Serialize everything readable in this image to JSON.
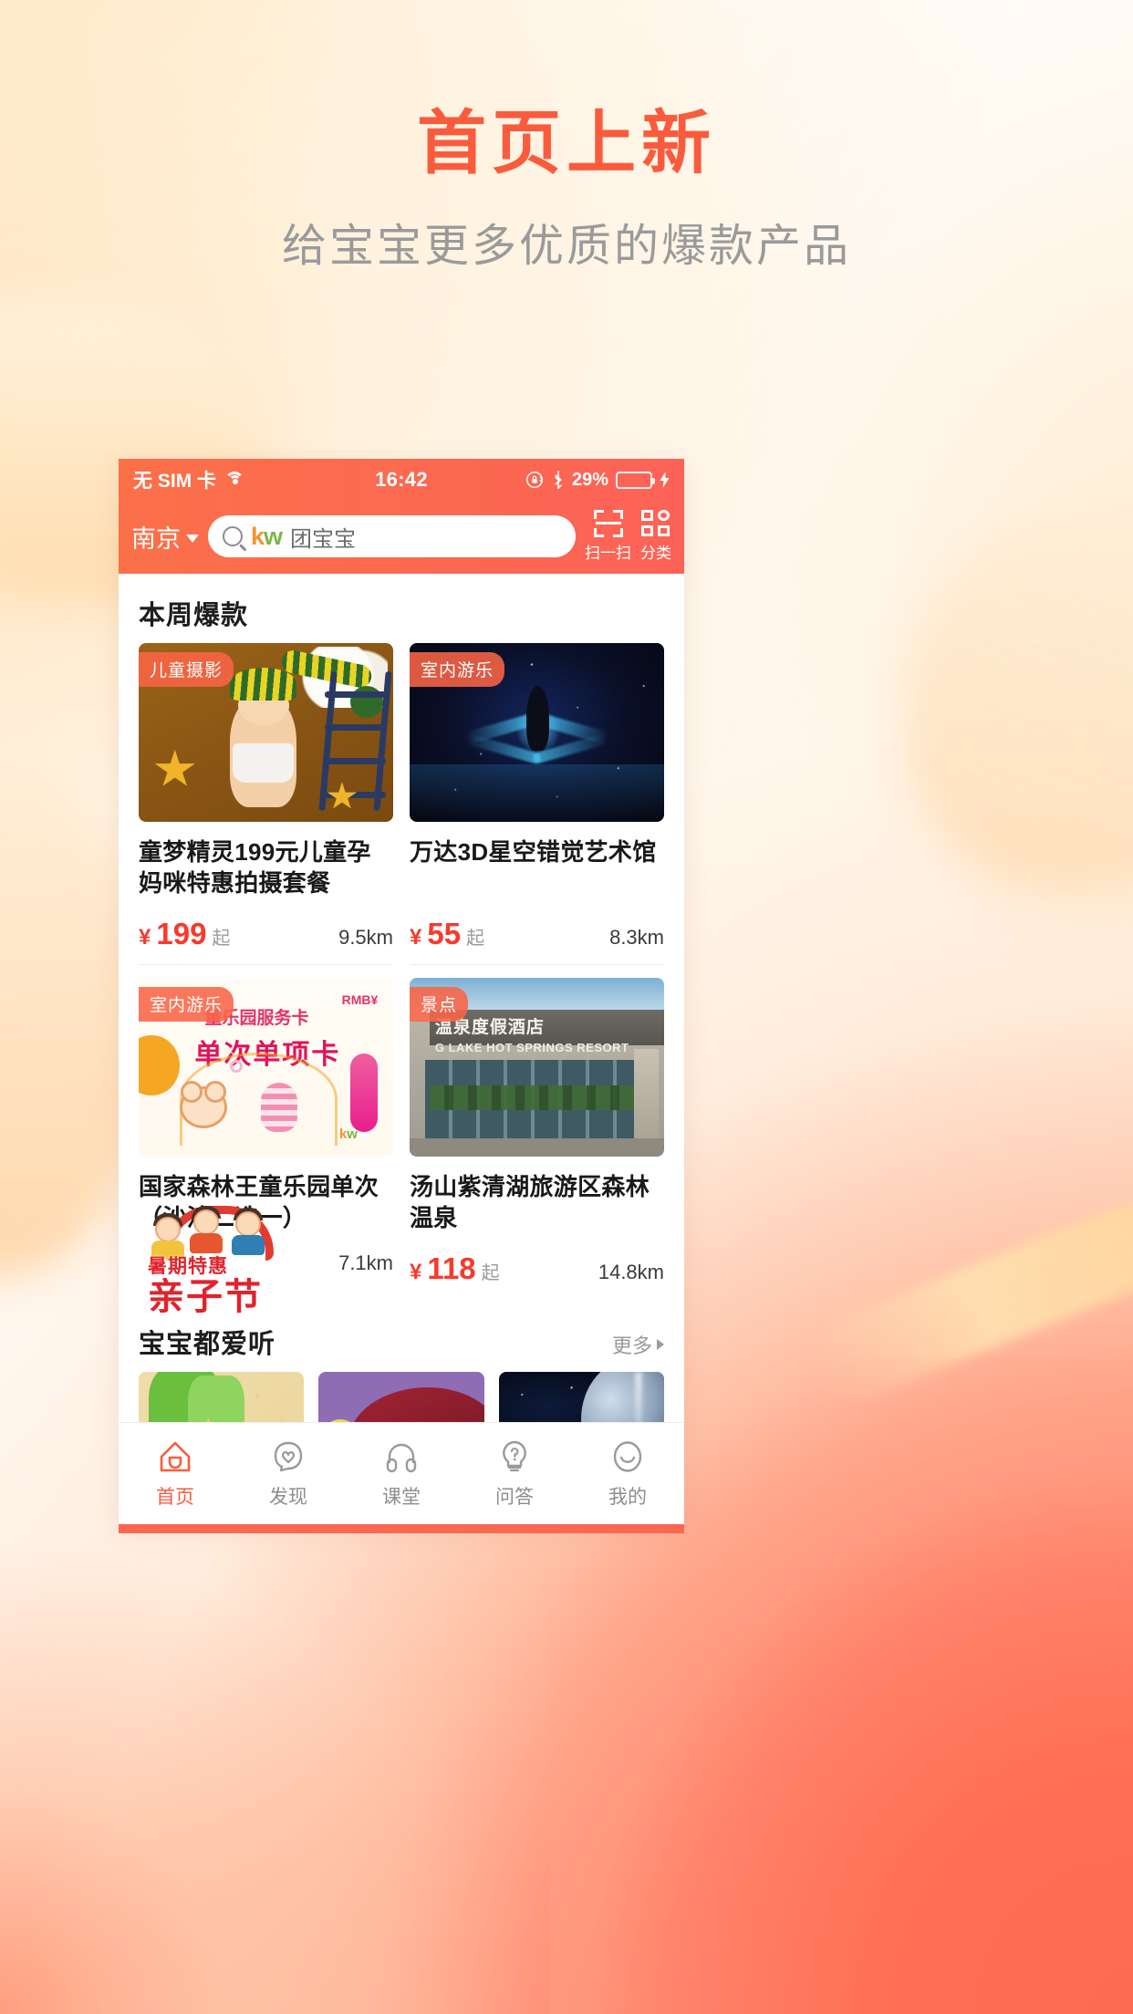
{
  "promo": {
    "title": "首页上新",
    "subtitle": "给宝宝更多优质的爆款产品",
    "title_color": "#fb5b3d",
    "subtitle_color": "#9a9a9a"
  },
  "status_bar": {
    "carrier": "无 SIM 卡",
    "wifi_icon": "wifi-icon",
    "time": "16:42",
    "rotation_lock_icon": "rotation-lock-icon",
    "bluetooth_icon": "bluetooth-icon",
    "battery_percent": "29%",
    "battery_level": 29,
    "battery_color": "#4cd964",
    "charging_icon": "lightning-bolt-icon"
  },
  "app_header": {
    "city": "南京",
    "city_chevron_icon": "chevron-down-icon",
    "search_icon": "search-icon",
    "brand_k": "k",
    "brand_w": "w",
    "search_placeholder": "团宝宝",
    "scan": {
      "icon": "scan-qr-icon",
      "label": "扫一扫"
    },
    "category": {
      "icon": "grid-category-icon",
      "label": "分类"
    },
    "bg_color": "#fb6a4e"
  },
  "sections": [
    {
      "title": "本周爆款",
      "more_label": "",
      "products": [
        {
          "badge": "儿童摄影",
          "title": "童梦精灵199元儿童孕妈咪特惠拍摄套餐",
          "currency": "¥",
          "price": "199",
          "price_suffix": "起",
          "distance": "9.5km",
          "thumb": "baby-photography-photo"
        },
        {
          "badge": "室内游乐",
          "title": "万达3D星空错觉艺术馆",
          "currency": "¥",
          "price": "55",
          "price_suffix": "起",
          "distance": "8.3km",
          "thumb": "3d-starry-illusion-art-photo"
        },
        {
          "badge": "室内游乐",
          "title": "国家森林王童乐园单次（沙池二选一）",
          "currency": "",
          "price": "",
          "price_suffix": "",
          "distance": "7.1km",
          "thumb": "play-park-service-card-graphic",
          "thumb_text": {
            "rmb": "RMB¥",
            "line1": "童乐园服务卡",
            "line2": "单次单项卡",
            "brand_k": "k",
            "brand_w": "w"
          },
          "overlay": {
            "top": "暑期特惠",
            "main": "亲子节"
          }
        },
        {
          "badge": "景点",
          "title": "汤山紫清湖旅游区森林温泉",
          "currency": "¥",
          "price": "118",
          "price_suffix": "起",
          "distance": "14.8km",
          "thumb": "hot-springs-resort-photo",
          "thumb_text": {
            "cn": "温泉度假酒店",
            "en": "G LAKE HOT SPRINGS RESORT"
          }
        }
      ]
    },
    {
      "title": "宝宝都爱听",
      "more_label": "更多",
      "more_icon": "triangle-right-icon",
      "audio_cards": [
        {
          "name": "green-frog-illustration-card"
        },
        {
          "name": "purple-red-dome-illustration-card"
        },
        {
          "name": "space-planet-photo-card"
        }
      ]
    }
  ],
  "tab_bar": {
    "items": [
      {
        "label": "首页",
        "icon": "home-icon",
        "active": true
      },
      {
        "label": "发现",
        "icon": "heart-bubble-icon",
        "active": false
      },
      {
        "label": "课堂",
        "icon": "headphones-icon",
        "active": false
      },
      {
        "label": "问答",
        "icon": "lightbulb-question-icon",
        "active": false
      },
      {
        "label": "我的",
        "icon": "smiley-face-icon",
        "active": false
      }
    ],
    "active_color": "#fb5b3d",
    "inactive_color": "#8d8d8d"
  }
}
